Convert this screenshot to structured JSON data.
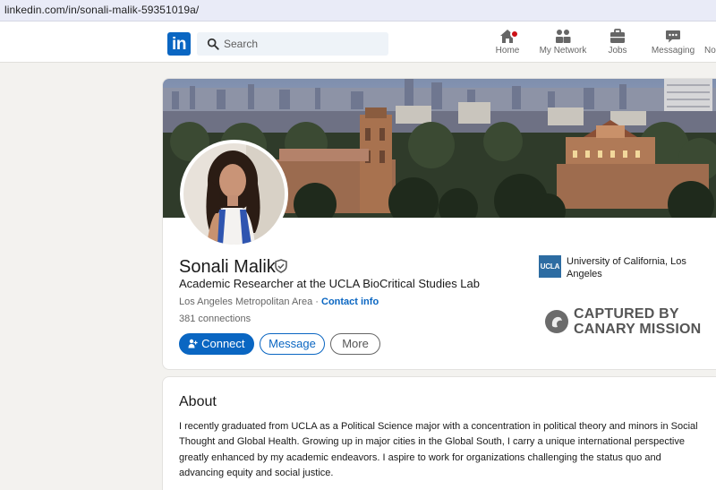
{
  "browser": {
    "url": "linkedin.com/in/sonali-malik-59351019a/"
  },
  "nav": {
    "logo": "in",
    "search_placeholder": "Search",
    "items": [
      {
        "label": "Home",
        "icon": "home-icon"
      },
      {
        "label": "My Network",
        "icon": "network-icon"
      },
      {
        "label": "Jobs",
        "icon": "briefcase-icon"
      },
      {
        "label": "Messaging",
        "icon": "messaging-icon"
      },
      {
        "label": "No",
        "icon": "bell-icon"
      }
    ]
  },
  "profile": {
    "name": "Sonali Malik",
    "headline": "Academic Researcher at the UCLA BioCritical Studies Lab",
    "location": "Los Angeles Metropolitan Area",
    "separator": " · ",
    "contact_label": "Contact info",
    "connections": "381 connections",
    "buttons": {
      "connect": "Connect",
      "message": "Message",
      "more": "More"
    },
    "education": {
      "logo_text": "UCLA",
      "name": "University of California, Los Angeles"
    }
  },
  "stamp": {
    "line1": "CAPTURED BY",
    "line2": "CANARY MISSION"
  },
  "about": {
    "title": "About",
    "text": "I recently graduated from UCLA as a Political Science major with a concentration in political theory and minors in Social Thought and Global Health. Growing up in major cities in the Global South, I carry a unique international perspective greatly enhanced by my academic endeavors. I aspire to work for organizations challenging the status quo and advancing equity and social justice."
  },
  "colors": {
    "brand": "#0a66c2",
    "page_bg": "#f3f2ef",
    "notification": "#cc1016"
  }
}
